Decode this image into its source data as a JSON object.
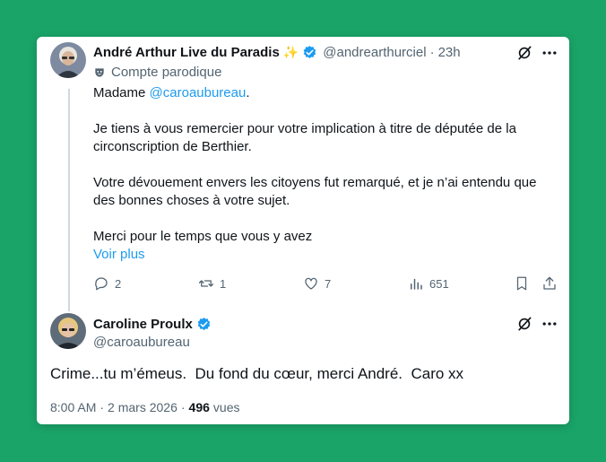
{
  "tweet": {
    "author_name": "André Arthur Live du Paradis",
    "sparkle": "✨",
    "handle": "@andrearthurciel",
    "separator": "·",
    "time": "23h",
    "parody_label": "Compte parodique",
    "greeting_prefix": "Madame ",
    "greeting_mention": "@caroaubureau",
    "greeting_suffix": ".",
    "para1": "Je tiens à vous remercier pour votre implication à titre de députée de la circonscription de Berthier.",
    "para2": "Votre dévouement envers les citoyens fut remarqué, et je n’ai entendu que des bonnes choses à votre sujet.",
    "para3": "Merci pour le temps que vous y avez",
    "show_more": "Voir plus",
    "replies": "2",
    "retweets": "1",
    "likes": "7",
    "views": "651"
  },
  "reply": {
    "author_name": "Caroline Proulx",
    "handle": "@caroaubureau",
    "text": "Crime...tu m’émeus.  Du fond du cœur, merci André.  Caro xx",
    "time": "8:00 AM",
    "separator": "·",
    "date": "2 mars 2026",
    "separator2": "·",
    "view_count": "496",
    "view_label": "vues"
  },
  "colors": {
    "background": "#1aa468",
    "link": "#1d9bf0",
    "verified": "#1d9bf0",
    "muted": "#536471"
  }
}
